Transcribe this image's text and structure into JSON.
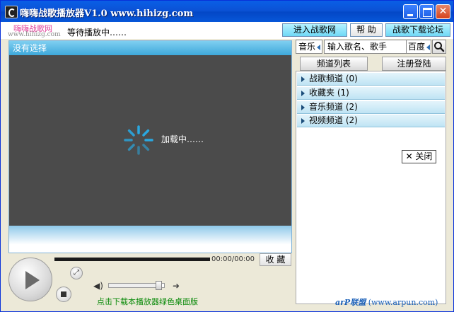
{
  "window": {
    "title": "嗨嗨战歌播放器V1.0 www.hihizg.com",
    "min_label": "_",
    "close_label": "✕"
  },
  "branding": {
    "logo_text": "嗨嗨战歌网",
    "logo_url": "www.hihizg.com"
  },
  "status": {
    "text": "等待播放中……"
  },
  "header_buttons": {
    "enter": "进入战歌网",
    "help": "帮 助",
    "forum": "战歌下载论坛"
  },
  "video": {
    "header": "没有选择",
    "loading_text": "加载中……"
  },
  "playback": {
    "time": "00:00/00:00",
    "favorite_label": "收 藏",
    "download_link": "点击下载本播放器绿色桌面版",
    "volume_level": 0.85
  },
  "search": {
    "category": "音乐",
    "placeholder": "输入歌名、歌手",
    "engine": "百度"
  },
  "tabs": [
    {
      "label": "频道列表",
      "active": true
    },
    {
      "label": "注册登陆",
      "active": false
    }
  ],
  "channels": [
    {
      "label": "战歌频道 (0)"
    },
    {
      "label": "收藏夹 (1)"
    },
    {
      "label": "音乐频道 (2)"
    },
    {
      "label": "视频频道 (2)"
    }
  ],
  "close_panel_label": "✕ 关闭",
  "footer": {
    "brand": "arP联盟",
    "url": "(www.arpun.com)"
  },
  "colors": {
    "titlebar": "#0b52d6",
    "accent_cyan": "#6fd9f6",
    "video_bg": "#4b4b4b",
    "spinner": "#2aa8e0",
    "download_link": "#0a8a0a"
  }
}
